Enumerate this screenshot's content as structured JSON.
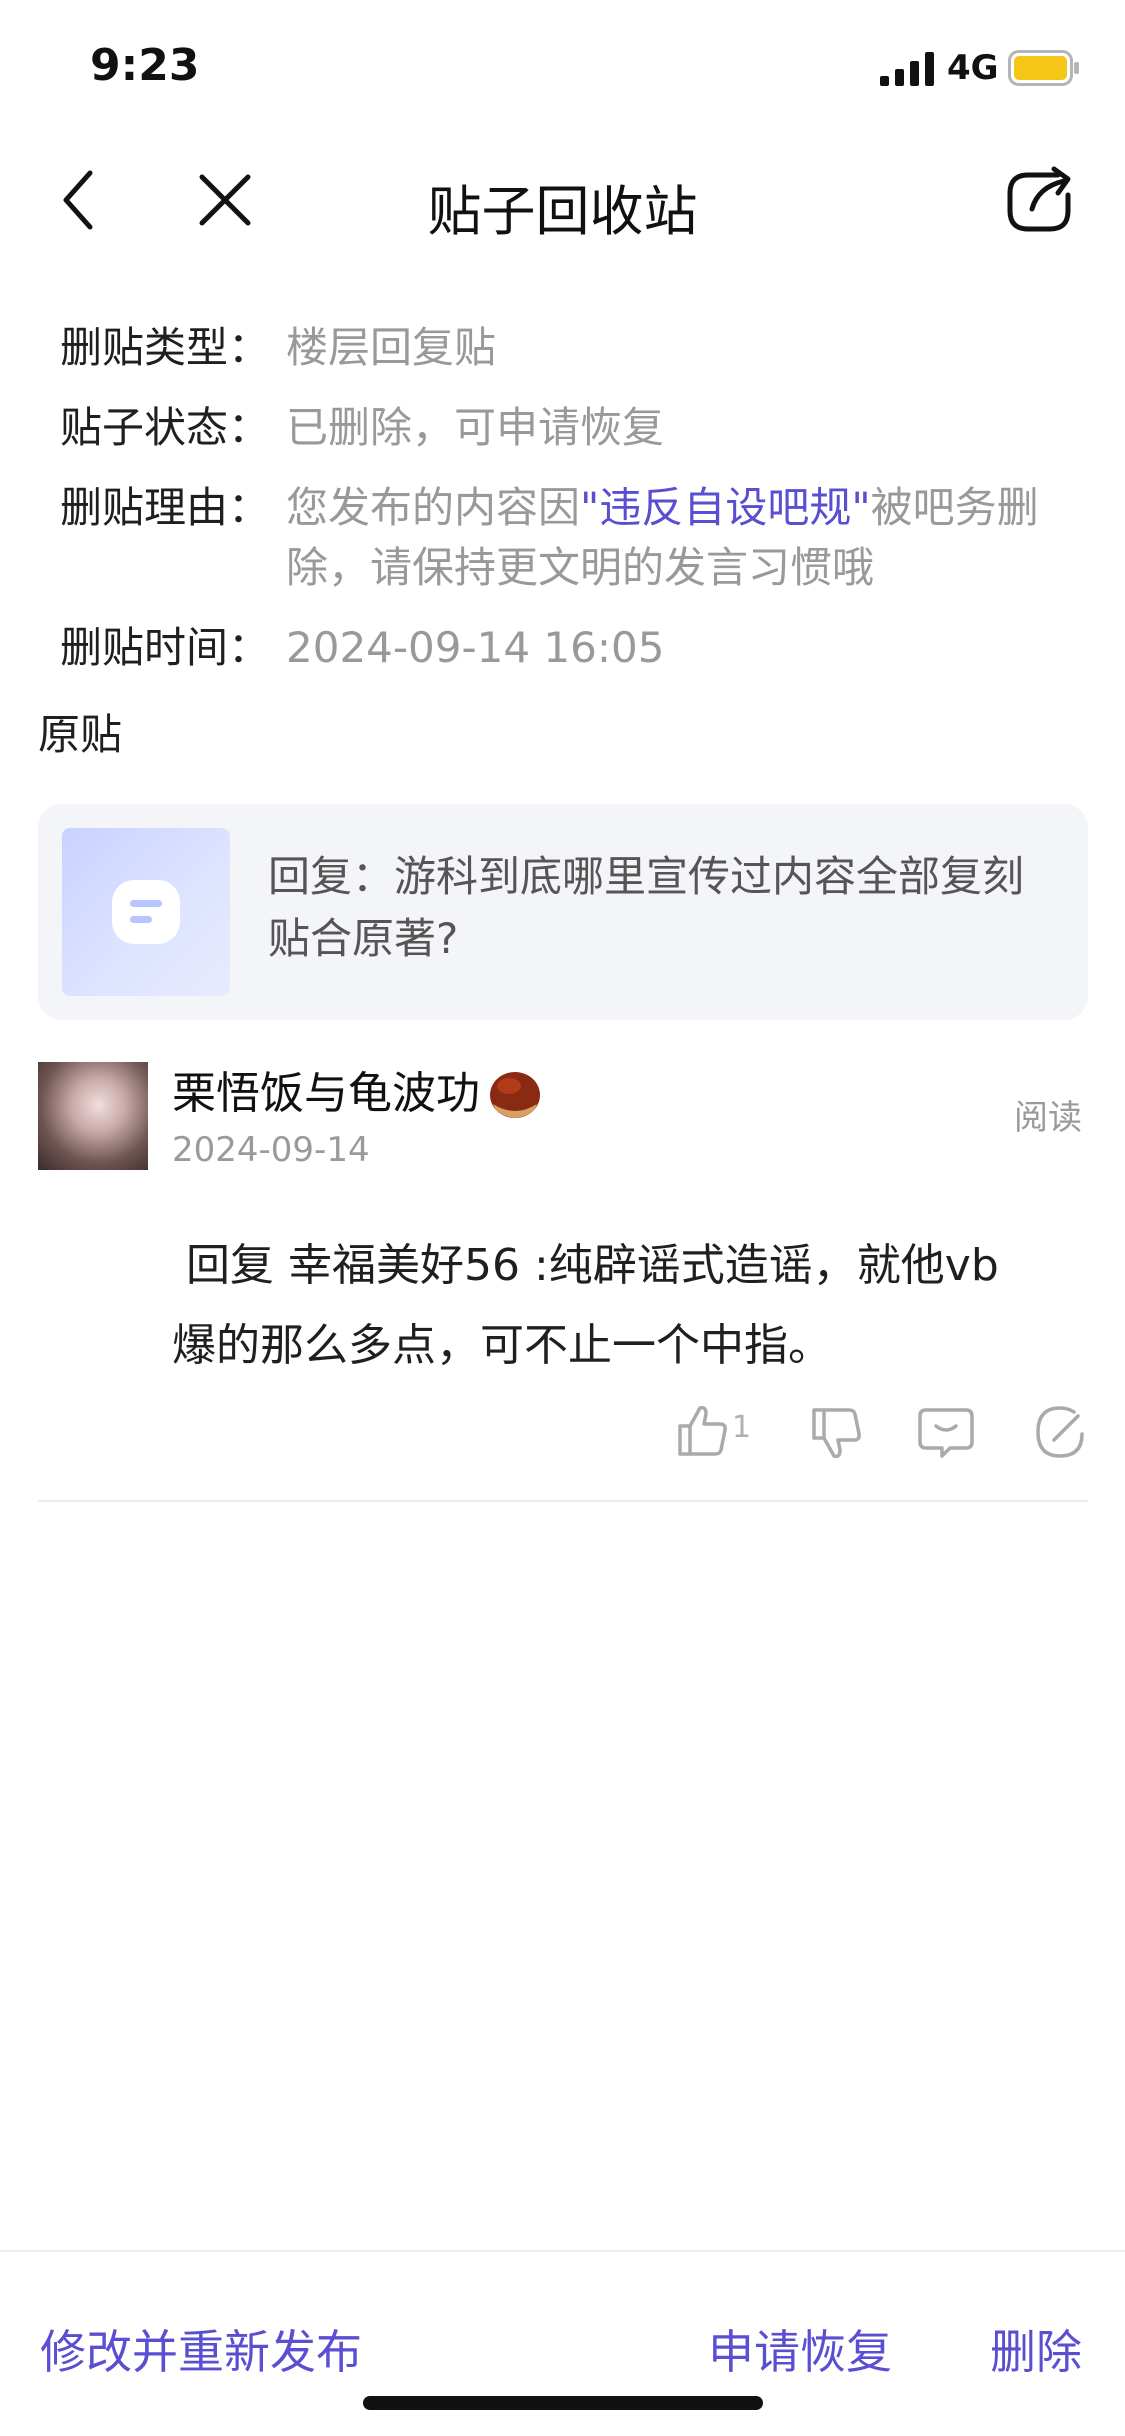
{
  "status_bar": {
    "time": "9:23",
    "network": "4G"
  },
  "nav": {
    "title": "贴子回收站"
  },
  "info": {
    "type_label": "删贴类型：",
    "type_value": "楼层回复贴",
    "status_label": "贴子状态：",
    "status_value": "已删除，可申请恢复",
    "reason_label": "删贴理由：",
    "reason_prefix": "您发布的内容因",
    "reason_highlight": "\"违反自设吧规\"",
    "reason_suffix": "被吧务删除，请保持更文明的发言习惯哦",
    "time_label": "删贴时间：",
    "time_value": "2024-09-14 16:05"
  },
  "original": {
    "section_title": "原贴",
    "text": "回复：游科到底哪里宣传过内容全部复刻贴合原著?"
  },
  "reply": {
    "username": "栗悟饭与龟波功",
    "date": "2024-09-14",
    "read_label": "阅读",
    "body_line1": "回复  幸福美好56 :纯辟谣式造谣，就他vb",
    "body_line2": "爆的那么多点，可不止一个中指。",
    "like_count": "1"
  },
  "bottom": {
    "edit_label": "修改并重新发布",
    "restore_label": "申请恢复",
    "delete_label": "删除"
  },
  "colors": {
    "accent": "#5b4fd1",
    "muted": "#999999",
    "battery": "#f5c518"
  },
  "icons": [
    "back-icon",
    "close-icon",
    "share-icon",
    "like-icon",
    "dislike-icon",
    "comment-icon",
    "edit-icon",
    "chestnut-emoji",
    "signal-icon",
    "battery-icon"
  ]
}
